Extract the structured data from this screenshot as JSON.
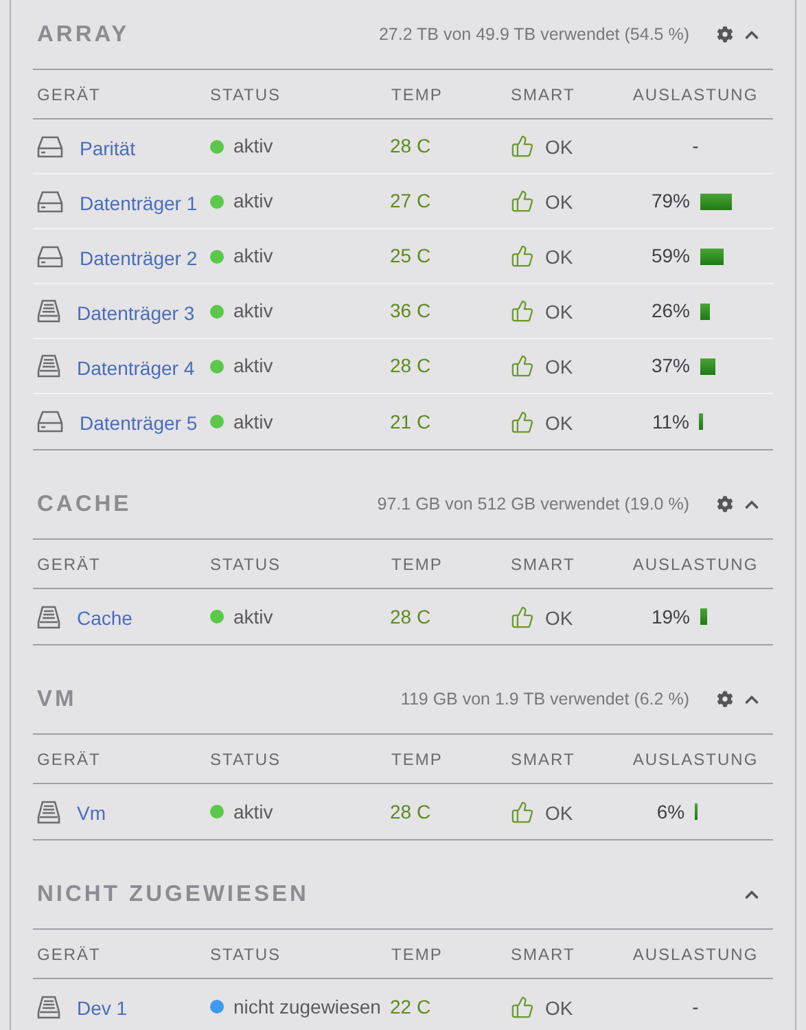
{
  "sections": [
    {
      "title": "ARRAY",
      "summary": "27.2 TB von 49.9 TB verwendet (54.5 %)",
      "settings": true,
      "expanded": true,
      "columns": [
        "GERÄT",
        "STATUS",
        "TEMP",
        "SMART",
        "AUSLASTUNG"
      ],
      "devices": [
        {
          "kind": "hdd",
          "name": "Parität",
          "status": "aktiv",
          "color": "#5bc84a",
          "temp": "28 C",
          "smart": "OK",
          "usage": "-"
        },
        {
          "kind": "hdd",
          "name": "Datenträger 1",
          "status": "aktiv",
          "color": "#5bc84a",
          "temp": "27 C",
          "smart": "OK",
          "usage": "79%"
        },
        {
          "kind": "hdd",
          "name": "Datenträger 2",
          "status": "aktiv",
          "color": "#5bc84a",
          "temp": "25 C",
          "smart": "OK",
          "usage": "59%"
        },
        {
          "kind": "ssd",
          "name": "Datenträger 3",
          "status": "aktiv",
          "color": "#5bc84a",
          "temp": "36 C",
          "smart": "OK",
          "usage": "26%"
        },
        {
          "kind": "ssd",
          "name": "Datenträger 4",
          "status": "aktiv",
          "color": "#5bc84a",
          "temp": "28 C",
          "smart": "OK",
          "usage": "37%"
        },
        {
          "kind": "hdd",
          "name": "Datenträger 5",
          "status": "aktiv",
          "color": "#5bc84a",
          "temp": "21 C",
          "smart": "OK",
          "usage": "11%"
        }
      ]
    },
    {
      "title": "CACHE",
      "summary": "97.1 GB von 512 GB verwendet (19.0 %)",
      "settings": true,
      "expanded": true,
      "columns": [
        "GERÄT",
        "STATUS",
        "TEMP",
        "SMART",
        "AUSLASTUNG"
      ],
      "devices": [
        {
          "kind": "ssd",
          "name": "Cache",
          "status": "aktiv",
          "color": "#5bc84a",
          "temp": "28 C",
          "smart": "OK",
          "usage": "19%"
        }
      ]
    },
    {
      "title": "VM",
      "summary": "119 GB von 1.9 TB verwendet (6.2 %)",
      "settings": true,
      "expanded": true,
      "columns": [
        "GERÄT",
        "STATUS",
        "TEMP",
        "SMART",
        "AUSLASTUNG"
      ],
      "devices": [
        {
          "kind": "ssd",
          "name": "Vm",
          "status": "aktiv",
          "color": "#5bc84a",
          "temp": "28 C",
          "smart": "OK",
          "usage": "6%"
        }
      ]
    },
    {
      "title": "NICHT ZUGEWIESEN",
      "settings": false,
      "expanded": true,
      "columns": [
        "GERÄT",
        "STATUS",
        "TEMP",
        "SMART",
        "AUSLASTUNG"
      ],
      "devices": [
        {
          "kind": "ssd",
          "name": "Dev 1",
          "status": "nicht zugewiesen",
          "color": "#3d9bf2",
          "temp": "22 C",
          "smart": "OK",
          "usage": "-"
        }
      ]
    }
  ]
}
